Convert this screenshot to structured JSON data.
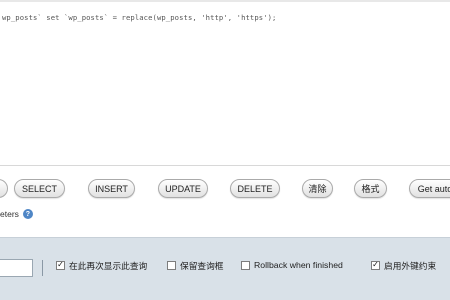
{
  "sql_editor": {
    "query_text": "wp_posts` set `wp_posts` = replace(wp_posts, 'http', 'https');"
  },
  "buttons": [
    {
      "id": "select",
      "label": "SELECT"
    },
    {
      "id": "insert",
      "label": "INSERT"
    },
    {
      "id": "update",
      "label": "UPDATE"
    },
    {
      "id": "delete",
      "label": "DELETE"
    },
    {
      "id": "clear",
      "label": "清除"
    },
    {
      "id": "format",
      "label": "格式"
    },
    {
      "id": "get_auto",
      "label": "Get auto"
    }
  ],
  "params_row": {
    "label": "eters",
    "help_icon": "help-icon"
  },
  "options": {
    "show_query_again": {
      "label": "在此再次显示此查询",
      "checked": true
    },
    "keep_query_box": {
      "label": "保留查询框",
      "checked": false
    },
    "rollback_when_finished": {
      "label": "Rollback when finished",
      "checked": false
    },
    "enable_foreign_key_checks": {
      "label": "启用外键约束",
      "checked": true
    }
  },
  "colors": {
    "options_bar_bg": "#d9e1e8",
    "button_border": "#aaaaaa",
    "help_icon": "#4f86c6"
  }
}
